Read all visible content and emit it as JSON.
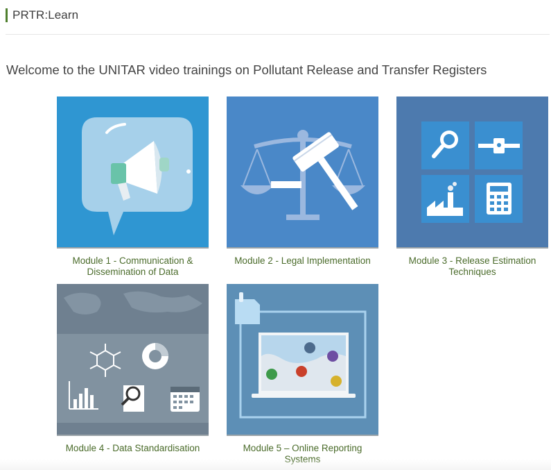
{
  "header": {
    "site_title": "PRTR:Learn"
  },
  "welcome_text": "Welcome to the UNITAR video trainings on Pollutant Release and Transfer Registers",
  "modules": [
    {
      "caption": "Module 1 - Communication & Dissemination of Data",
      "icon": "megaphone-icon",
      "bg": "#2f96d2"
    },
    {
      "caption": "Module 2 - Legal Implementation",
      "icon": "gavel-scales-icon",
      "bg": "#4a88c8"
    },
    {
      "caption": "Module 3 - Release Estimation Techniques",
      "icon": "estimation-grid-icon",
      "bg": "#4d7aae"
    },
    {
      "caption": "Module 4 - Data Standardisation",
      "icon": "data-standardisation-icon",
      "bg": "#8192a0"
    },
    {
      "caption": "Module 5 – Online Reporting Systems",
      "icon": "online-map-laptop-icon",
      "bg": "#5d8fb6"
    }
  ],
  "colors": {
    "caption_green": "#4a6b2a",
    "brand_bar": "#4f7f2e"
  }
}
